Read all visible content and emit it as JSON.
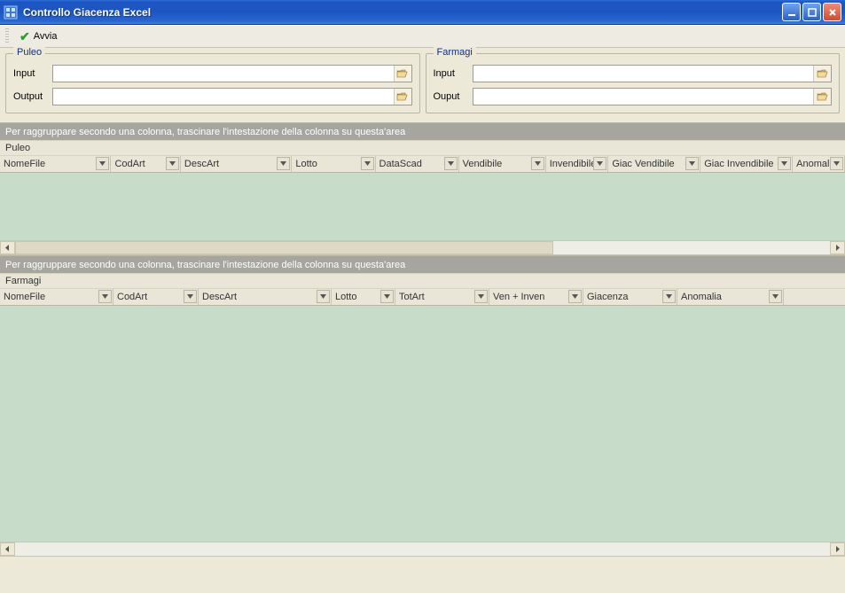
{
  "window": {
    "title": "Controllo Giacenza Excel"
  },
  "toolbar": {
    "avvia_label": "Avvia"
  },
  "panels": {
    "puleo": {
      "title": "Puleo",
      "input_label": "Input",
      "input_value": "",
      "output_label": "Output",
      "output_value": ""
    },
    "farmagi": {
      "title": "Farmagi",
      "input_label": "Input",
      "input_value": "",
      "output_label": "Ouput",
      "output_value": ""
    }
  },
  "groupby_hint": "Per raggruppare secondo una colonna, trascinare l'intestazione della colonna su questa'area",
  "grid1": {
    "section_label": "Puleo",
    "columns": [
      "NomeFile",
      "CodArt",
      "DescArt",
      "Lotto",
      "DataScad",
      "Vendibile",
      "Invendibile",
      "Giac Vendibile",
      "Giac Invendibile",
      "Anomali"
    ],
    "rows": []
  },
  "grid2": {
    "section_label": "Farmagi",
    "columns": [
      "NomeFile",
      "CodArt",
      "DescArt",
      "Lotto",
      "TotArt",
      "Ven + Inven",
      "Giacenza",
      "Anomalia"
    ],
    "rows": []
  }
}
